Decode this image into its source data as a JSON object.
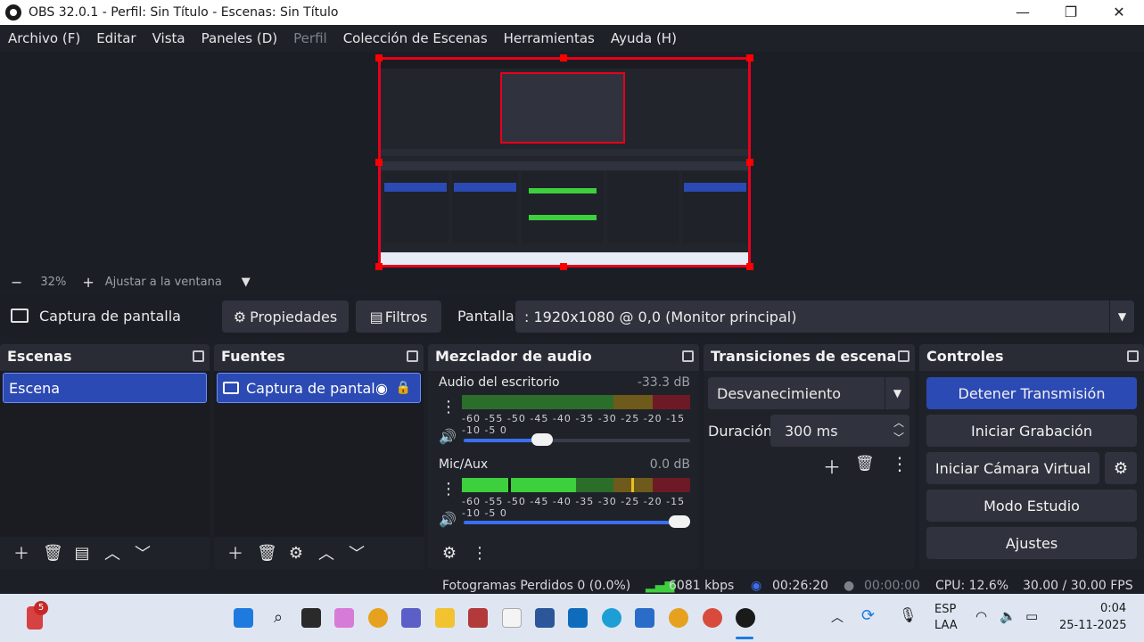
{
  "window": {
    "title": "OBS 32.0.1 - Perfil: Sin Título - Escenas: Sin Título",
    "minimize": "—",
    "maximize": "❐",
    "close": "✕"
  },
  "menu": [
    "Archivo (F)",
    "Editar",
    "Vista",
    "Paneles (D)",
    "Perfil",
    "Colección de Escenas",
    "Herramientas",
    "Ayuda (H)"
  ],
  "zoom": {
    "minus": "−",
    "value": "32%",
    "plus": "+",
    "fit_label": "Ajustar a la ventana"
  },
  "source_toolbar": {
    "source_name": "Captura de pantalla",
    "properties": "Propiedades",
    "filters": "Filtros",
    "display_label": "Pantalla",
    "display_value": ": 1920x1080 @ 0,0 (Monitor principal)"
  },
  "scenes": {
    "title": "Escenas",
    "items": [
      "Escena"
    ]
  },
  "sources": {
    "title": "Fuentes",
    "items": [
      "Captura de pantal"
    ]
  },
  "mixer": {
    "title": "Mezclador de audio",
    "channels": [
      {
        "name": "Audio del escritorio",
        "db": "-33.3 dB",
        "volume": 0.33
      },
      {
        "name": "Mic/Aux",
        "db": "0.0 dB",
        "volume": 1.0
      }
    ],
    "scale": "-60 -55 -50 -45 -40 -35 -30 -25 -20 -15 -10  -5   0"
  },
  "transitions": {
    "title": "Transiciones de escena",
    "type": "Desvanecimiento",
    "duration_label": "Duración",
    "duration_value": "300 ms"
  },
  "controls": {
    "title": "Controles",
    "stop_stream": "Detener Transmisión",
    "start_recording": "Iniciar Grabación",
    "start_virtual_cam": "Iniciar Cámara Virtual",
    "studio_mode": "Modo Estudio",
    "settings": "Ajustes"
  },
  "status": {
    "dropped_frames": "Fotogramas Perdidos 0 (0.0%)",
    "bitrate": "6081 kbps",
    "stream_time": "00:26:20",
    "record_time": "00:00:00",
    "cpu": "CPU: 12.6%",
    "fps": "30.00 / 30.00 FPS"
  },
  "taskbar": {
    "badge": "5",
    "lang_top": "ESP",
    "lang_bottom": "LAA",
    "time": "0:04",
    "date": "25-11-2025"
  },
  "colors": {
    "accent": "#2c4ab3",
    "selection_border": "#e8001c",
    "meter_green": "#3ecf3e",
    "meter_yellow": "#c9a21a",
    "meter_red": "#c8203a"
  }
}
